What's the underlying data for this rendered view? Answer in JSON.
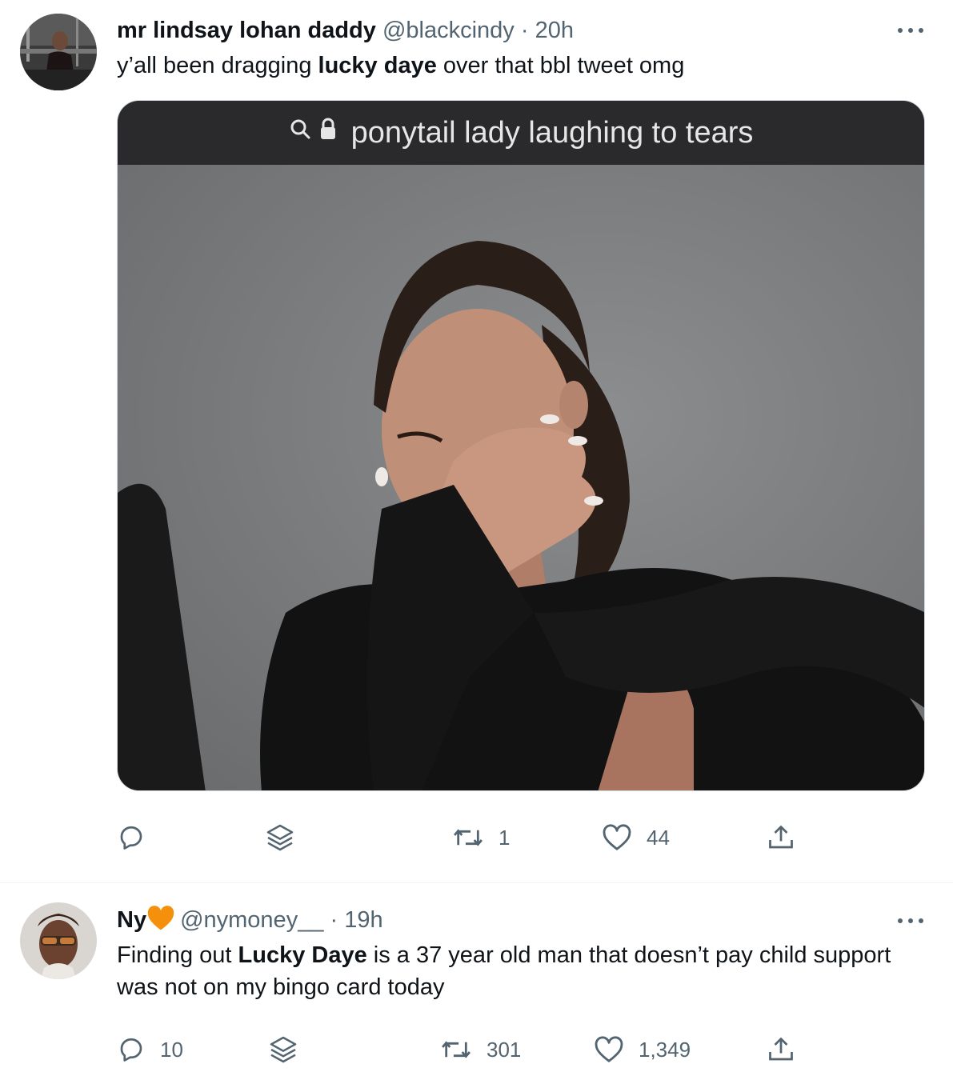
{
  "tweets": [
    {
      "display_name": "mr lindsay lohan daddy",
      "handle": "@blackcindy",
      "separator": "·",
      "time": "20h",
      "text_parts": [
        "y’all been dragging ",
        "lucky daye",
        " over that bbl tweet omg"
      ],
      "media": {
        "search_query": "ponytail lady laughing to tears",
        "icons": [
          "search-icon",
          "lock-icon"
        ]
      },
      "actions": {
        "reply": "",
        "stack": "",
        "retweet": "1",
        "like": "44",
        "share": ""
      }
    },
    {
      "display_name": "Ny",
      "name_emoji": "orange-heart",
      "handle": "@nymoney__",
      "separator": "·",
      "time": "19h",
      "text_line1_parts": [
        "Finding out ",
        "Lucky Daye",
        " is a 37 year old man that doesn’t pay child support"
      ],
      "text_line2": "was not on my bingo card today",
      "actions": {
        "reply": "10",
        "stack": "",
        "retweet": "301",
        "like": "1,349",
        "share": ""
      }
    }
  ],
  "colors": {
    "text_primary": "#0f1419",
    "text_secondary": "#536471",
    "divider": "#eff3f4",
    "heart_emoji": "#f4900c"
  }
}
